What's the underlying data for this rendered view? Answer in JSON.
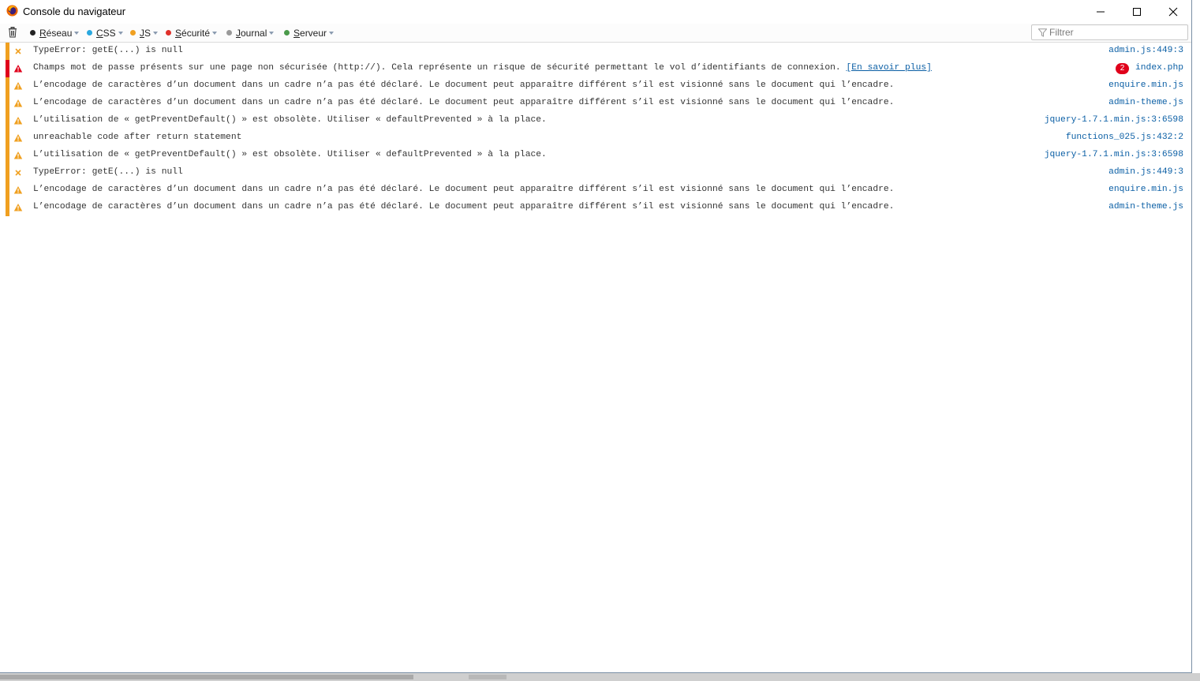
{
  "window": {
    "title": "Console du navigateur"
  },
  "toolbar": {
    "filters": [
      {
        "label": "Réseau",
        "accel": "R",
        "rest": "éseau",
        "color": "#222222"
      },
      {
        "label": "CSS",
        "accel": "C",
        "rest": "SS",
        "color": "#2aa8df"
      },
      {
        "label": "JS",
        "accel": "J",
        "rest": "S",
        "color": "#f0a020"
      },
      {
        "label": "Sécurité",
        "accel": "S",
        "rest": "écurité",
        "color": "#e0302a"
      },
      {
        "label": "Journal",
        "accel": "J",
        "rest": "ournal",
        "color": "#999999"
      },
      {
        "label": "Serveur",
        "accel": "S",
        "rest": "erveur",
        "color": "#4a9a4a"
      }
    ],
    "search_placeholder": "Filtrer"
  },
  "messages": [
    {
      "level": "error",
      "bar": "#f0a020",
      "text": "TypeError: getE(...) is null",
      "link": "",
      "source": "admin.js",
      "line": ":449:3",
      "badge": ""
    },
    {
      "level": "security",
      "bar": "#e0001b",
      "text": "Champs mot de passe présents sur une page non sécurisée (http://). Cela représente un risque de sécurité permettant le vol d’identifiants de connexion. ",
      "link": "[En savoir plus]",
      "source": "index.php",
      "line": "",
      "badge": "2"
    },
    {
      "level": "warning",
      "bar": "#f0a020",
      "text": "L’encodage de caractères d’un document dans un cadre n’a pas été déclaré. Le document peut apparaître différent s’il est visionné sans le document qui l’encadre.",
      "link": "",
      "source": "enquire.min.js",
      "line": "",
      "badge": ""
    },
    {
      "level": "warning",
      "bar": "#f0a020",
      "text": "L’encodage de caractères d’un document dans un cadre n’a pas été déclaré. Le document peut apparaître différent s’il est visionné sans le document qui l’encadre.",
      "link": "",
      "source": "admin-theme.js",
      "line": "",
      "badge": ""
    },
    {
      "level": "warning",
      "bar": "#f0a020",
      "text": "L’utilisation de « getPreventDefault() » est obsolète. Utiliser « defaultPrevented » à la place.",
      "link": "",
      "source": "jquery-1.7.1.min.js",
      "line": ":3:6598",
      "badge": ""
    },
    {
      "level": "warning",
      "bar": "#f0a020",
      "text": "unreachable code after return statement",
      "link": "",
      "source": "functions_025.js",
      "line": ":432:2",
      "badge": ""
    },
    {
      "level": "warning",
      "bar": "#f0a020",
      "text": "L’utilisation de « getPreventDefault() » est obsolète. Utiliser « defaultPrevented » à la place.",
      "link": "",
      "source": "jquery-1.7.1.min.js",
      "line": ":3:6598",
      "badge": ""
    },
    {
      "level": "error",
      "bar": "#f0a020",
      "text": "TypeError: getE(...) is null",
      "link": "",
      "source": "admin.js",
      "line": ":449:3",
      "badge": ""
    },
    {
      "level": "warning",
      "bar": "#f0a020",
      "text": "L’encodage de caractères d’un document dans un cadre n’a pas été déclaré. Le document peut apparaître différent s’il est visionné sans le document qui l’encadre.",
      "link": "",
      "source": "enquire.min.js",
      "line": "",
      "badge": ""
    },
    {
      "level": "warning",
      "bar": "#f0a020",
      "text": "L’encodage de caractères d’un document dans un cadre n’a pas été déclaré. Le document peut apparaître différent s’il est visionné sans le document qui l’encadre.",
      "link": "",
      "source": "admin-theme.js",
      "line": "",
      "badge": ""
    }
  ]
}
